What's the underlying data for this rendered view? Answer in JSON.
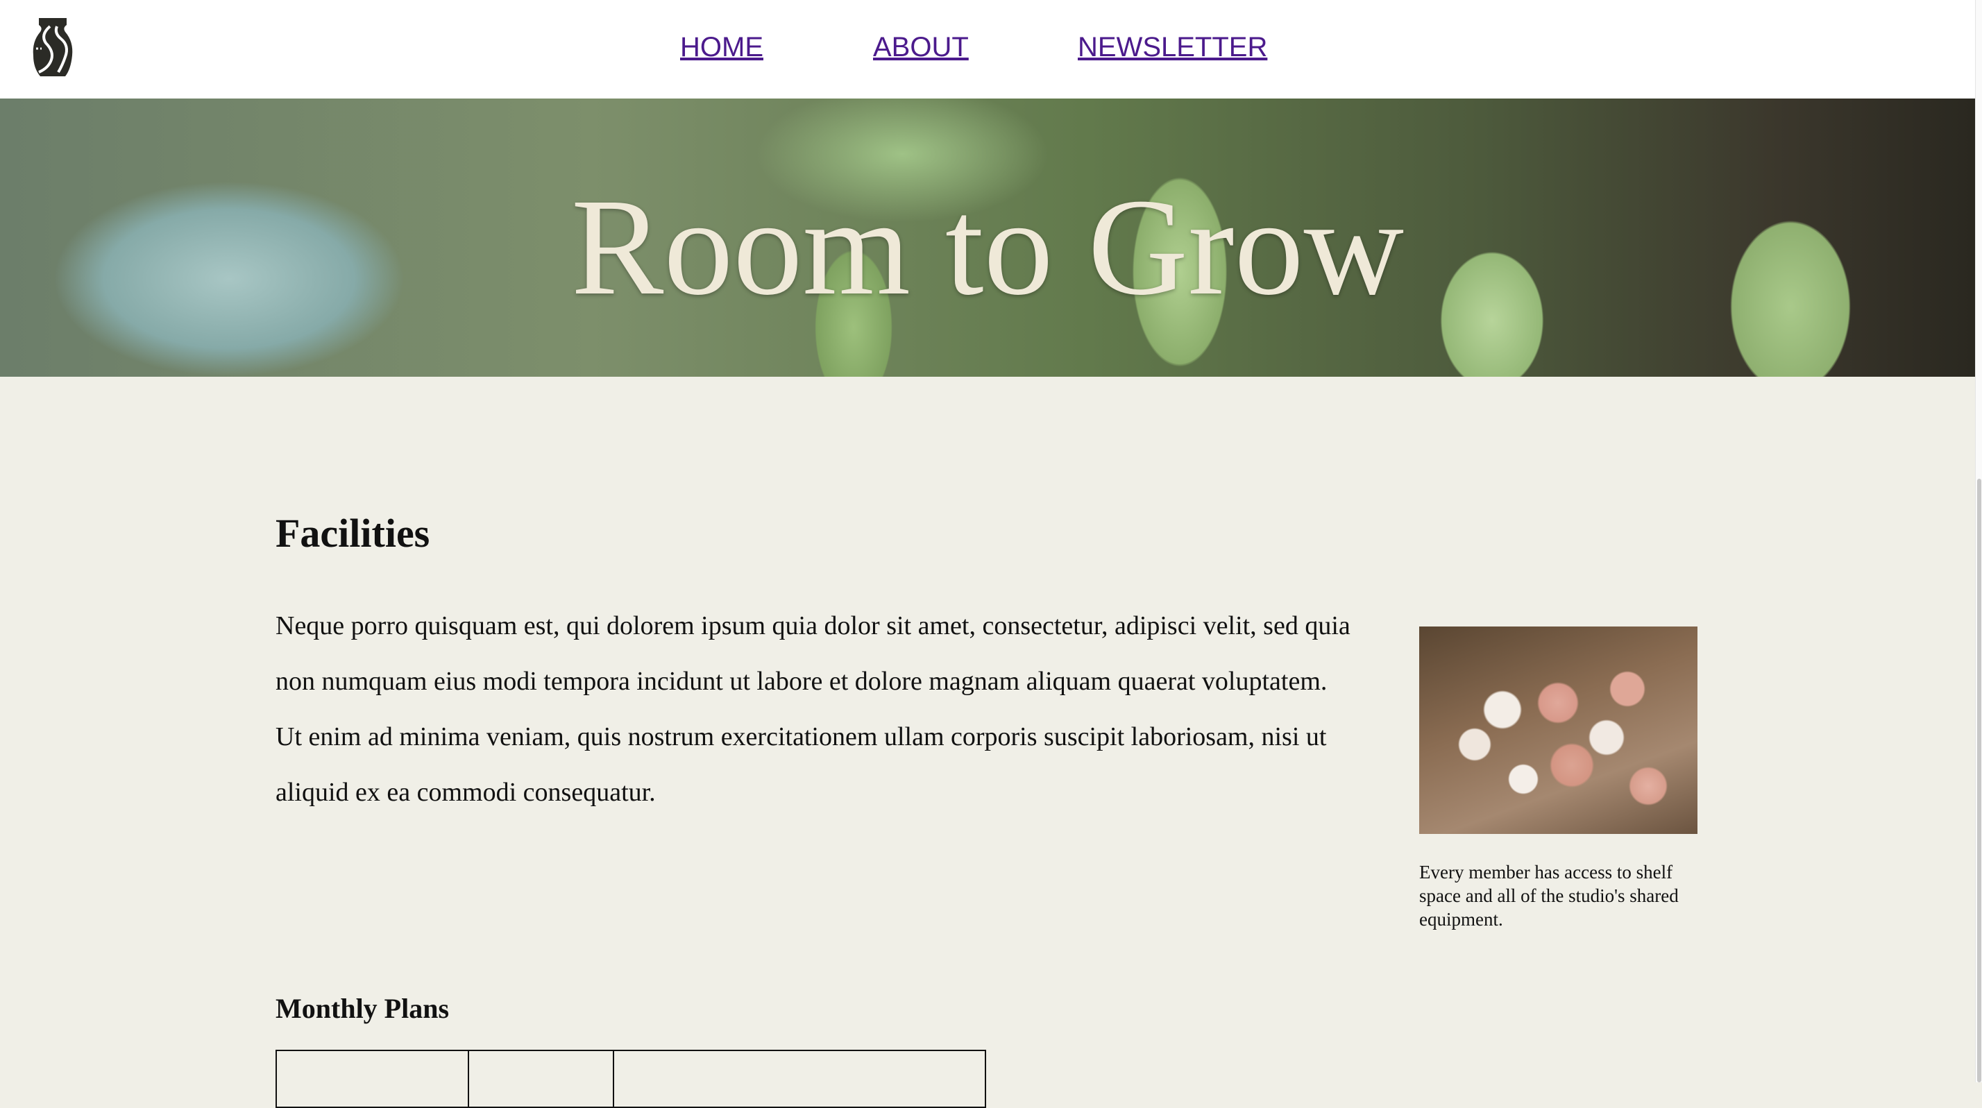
{
  "nav": {
    "items": [
      {
        "label": "HOME"
      },
      {
        "label": "ABOUT"
      },
      {
        "label": "NEWSLETTER"
      }
    ]
  },
  "hero": {
    "title": "Room to Grow"
  },
  "facilities": {
    "heading": "Facilities",
    "body": "Neque porro quisquam est, qui dolorem ipsum quia dolor sit amet, consectetur, adipisci velit, sed quia non numquam eius modi tempora incidunt ut labore et dolore magnam aliquam quaerat voluptatem. Ut enim ad minima veniam, quis nostrum exercitationem ullam corporis suscipit laboriosam, nisi ut aliquid ex ea commodi consequatur.",
    "image_caption": "Every member has access to shelf space and all of the studio's shared equipment."
  },
  "plans": {
    "heading": "Monthly Plans"
  },
  "colors": {
    "link": "#4b1a8c",
    "background": "#f0efe7",
    "hero_title": "#efe9d8"
  }
}
